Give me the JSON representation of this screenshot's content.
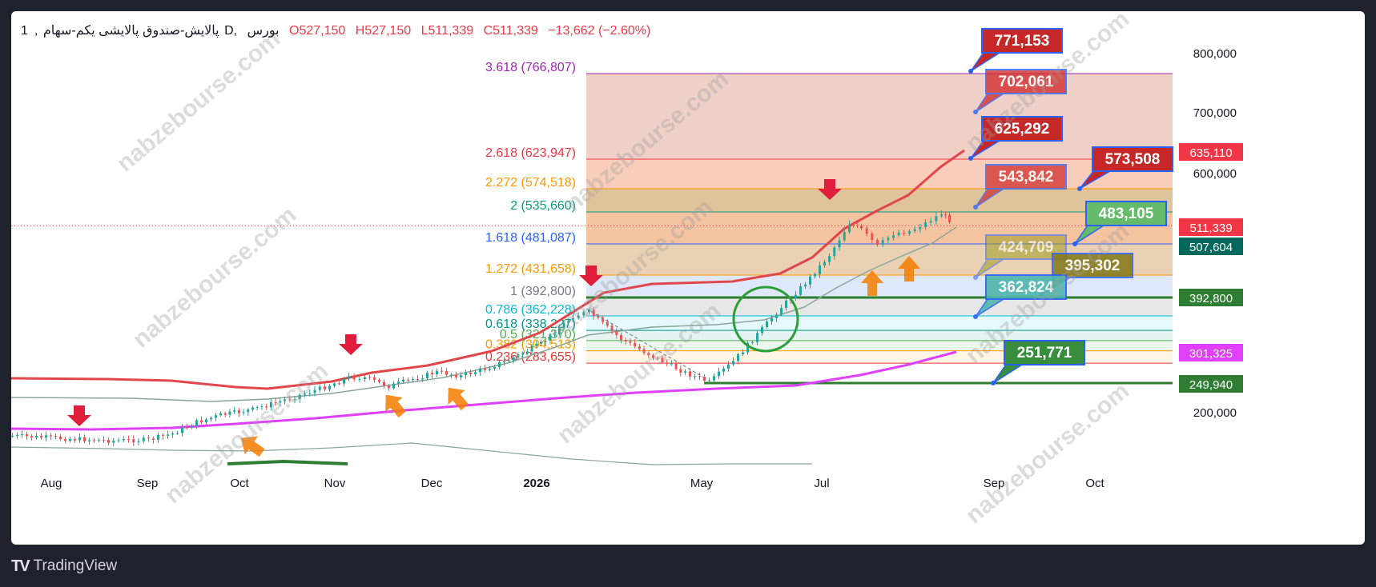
{
  "header": {
    "interval": "1",
    "symbol": "پالایش-صندوق پالایشی یکم-سهام",
    "timeframe": "D",
    "exchange": "بورس",
    "open": "O527,150",
    "high": "H527,150",
    "low": "L511,339",
    "close": "C511,339",
    "change": "−13,662 (−2.60%)"
  },
  "footer": {
    "brand": "TradingView",
    "logo": "TV"
  },
  "watermark": {
    "text": "nabzebourse.com"
  },
  "colors": {
    "up": "#26a69a",
    "down": "#ef5350",
    "emaRed": "#e0474c",
    "magenta": "#e040fb",
    "greenLevel": "#2e7d32",
    "bandGrey": "#8aa69c"
  },
  "chart_data": {
    "type": "candlestick",
    "symbol": "پالایش",
    "x_axis": {
      "labels": [
        "Aug",
        "Sep",
        "Oct",
        "Nov",
        "Dec",
        "2026",
        "May",
        "Jul",
        "Sep",
        "Oct"
      ]
    },
    "y_axis": {
      "ticks": [
        "800,000",
        "700,000",
        "600,000",
        "200,000"
      ]
    },
    "last_price": 511339,
    "fib_extension": [
      {
        "ratio": "0.236",
        "price": "(283,655)",
        "value": 283655,
        "color": "#e53935",
        "fill": "#fff3e0"
      },
      {
        "ratio": "0.382",
        "price": "(304,513)",
        "value": 304513,
        "color": "#ff9800",
        "fill": "#e8f5e9"
      },
      {
        "ratio": "0.5",
        "price": "(321,370)",
        "value": 321370,
        "color": "#4caf50",
        "fill": "#e0f2f1"
      },
      {
        "ratio": "0.618",
        "price": "(338,227)",
        "value": 338227,
        "color": "#009688",
        "fill": "#e0f7fa"
      },
      {
        "ratio": "0.786",
        "price": "(362,228)",
        "value": 362228,
        "color": "#00bcd4",
        "fill": "#e3e3e3"
      },
      {
        "ratio": "1",
        "price": "(392,800)",
        "value": 392800,
        "color": "#787b86",
        "fill": "#d8e4f7"
      },
      {
        "ratio": "1.272",
        "price": "(431,658)",
        "value": 431658,
        "color": "#ff9800",
        "fill": "#e8c9a6"
      },
      {
        "ratio": "1.618",
        "price": "(481,087)",
        "value": 481087,
        "color": "#2962ff",
        "fill": "#f2b88f"
      },
      {
        "ratio": "2",
        "price": "(535,660)",
        "value": 535660,
        "color": "#089981",
        "fill": "#d9b88a"
      },
      {
        "ratio": "2.272",
        "price": "(574,518)",
        "value": 574518,
        "color": "#ff9800",
        "fill": "#f7c6ae"
      },
      {
        "ratio": "2.618",
        "price": "(623,947)",
        "value": 623947,
        "color": "#f23645",
        "fill": "#ecc8bd"
      },
      {
        "ratio": "3.618",
        "price": "(766,807)",
        "value": 766807,
        "color": "#9c27b0",
        "fill": null
      }
    ],
    "price_tags": [
      {
        "text": "635,110",
        "bg": "#f23645",
        "color": "#ffffff"
      },
      {
        "text": "511,339",
        "bg": "#f23645",
        "color": "#ffffff"
      },
      {
        "text": "507,604",
        "bg": "#00695c",
        "color": "#ffffff"
      },
      {
        "text": "392,800",
        "bg": "#2e7d32",
        "color": "#ffffff"
      },
      {
        "text": "301,325",
        "bg": "#e040fb",
        "color": "#ffffff"
      },
      {
        "text": "249,940",
        "bg": "#2e7d32",
        "color": "#ffffff"
      }
    ],
    "callouts": [
      {
        "text": "771,153",
        "bg": "#c62828",
        "alpha": 1,
        "tcolor": "#ffffff"
      },
      {
        "text": "702,061",
        "bg": "#d32f2f",
        "alpha": 0.8,
        "tcolor": "#ffffff"
      },
      {
        "text": "625,292",
        "bg": "#c62828",
        "alpha": 1,
        "tcolor": "#ffffff"
      },
      {
        "text": "543,842",
        "bg": "#d32f2f",
        "alpha": 0.75,
        "tcolor": "#ffffff"
      },
      {
        "text": "573,508",
        "bg": "#c62828",
        "alpha": 1,
        "tcolor": "#ffffff"
      },
      {
        "text": "483,105",
        "bg": "#66bb6a",
        "alpha": 1,
        "tcolor": "#ffffff"
      },
      {
        "text": "424,709",
        "bg": "#9e9d24",
        "alpha": 0.55,
        "tcolor": "#ffffff"
      },
      {
        "text": "395,302",
        "bg": "#827717",
        "alpha": 0.85,
        "tcolor": "#ffffff"
      },
      {
        "text": "362,824",
        "bg": "#4db6ac",
        "alpha": 0.9,
        "tcolor": "#ffffff"
      },
      {
        "text": "251,771",
        "bg": "#388e3c",
        "alpha": 1,
        "tcolor": "#ffffff"
      }
    ],
    "horizontal_levels": [
      392800,
      249940
    ],
    "annotations": {
      "down_arrows": 5,
      "up_arrows_orange": 6,
      "circle": "green breakout marker"
    }
  }
}
